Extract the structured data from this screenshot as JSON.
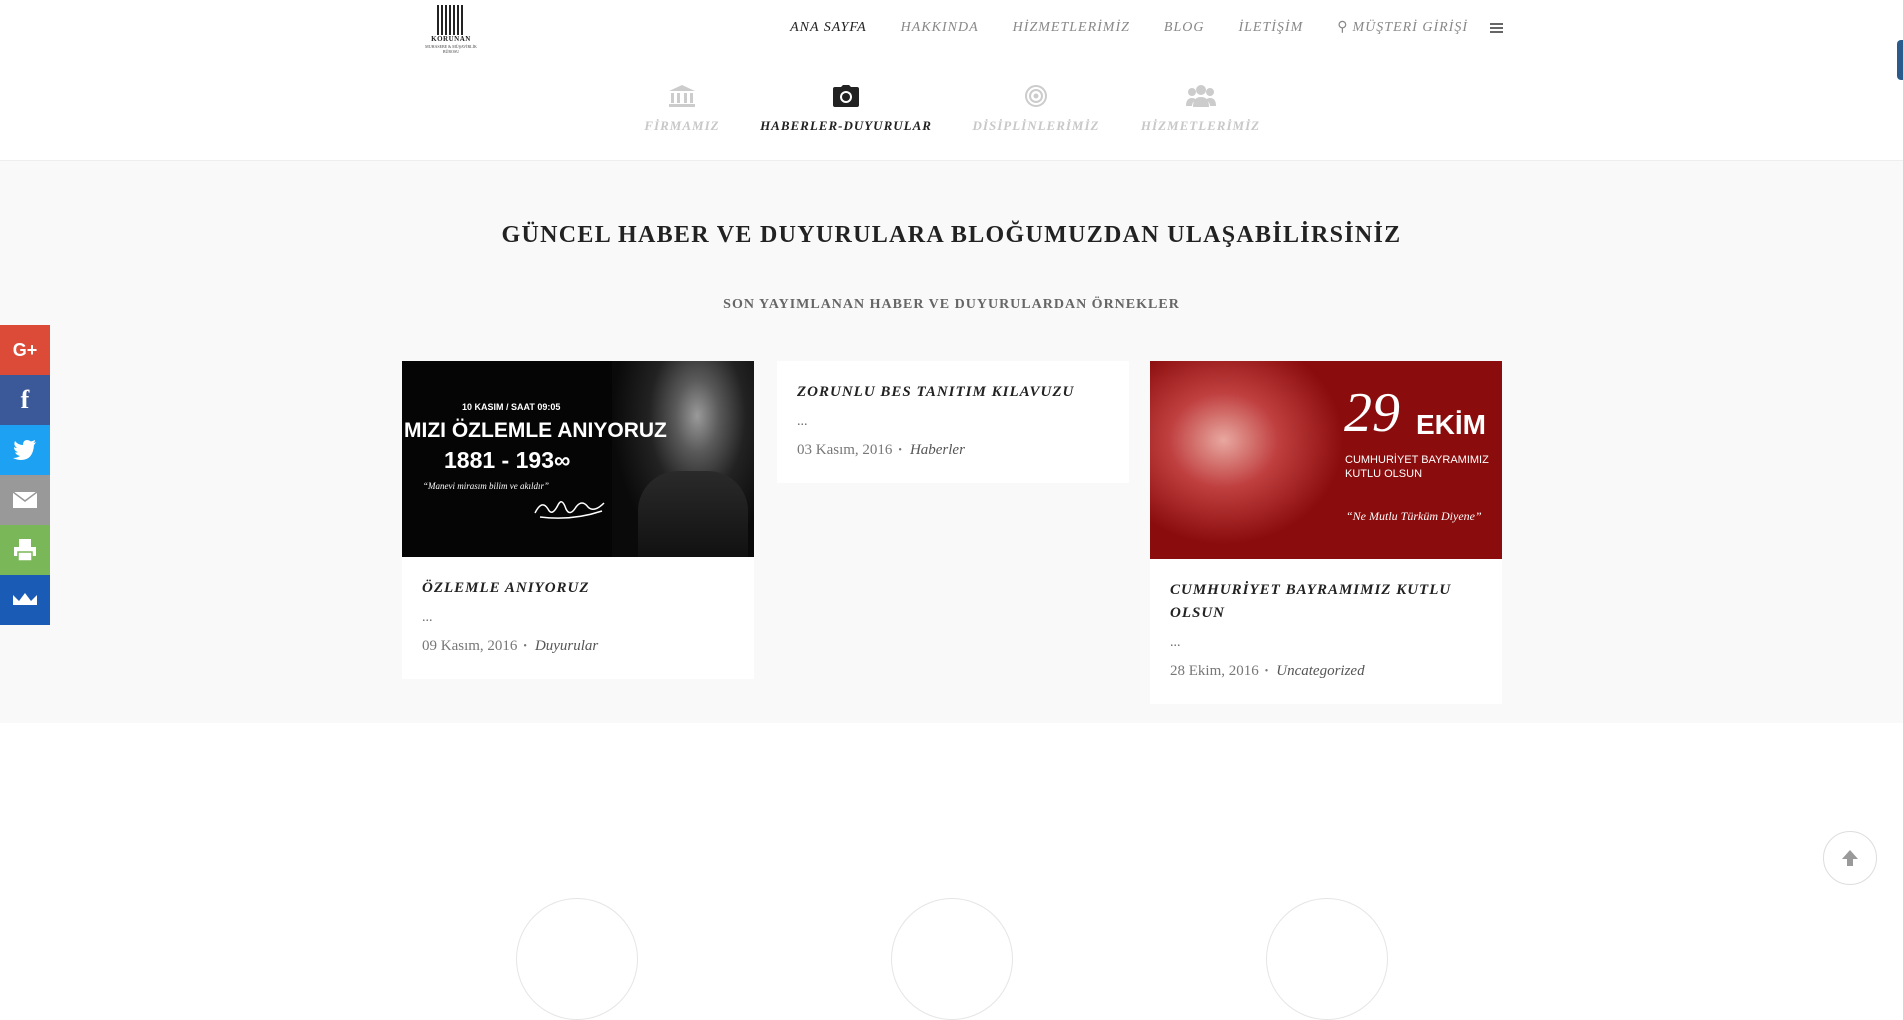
{
  "logo": {
    "name": "KORUNAN",
    "tagline": "MUHASEBE & MÜŞAVİRLİK BÜROSU"
  },
  "nav": {
    "items": [
      "ANA SAYFA",
      "HAKKINDA",
      "HİZMETLERİMİZ",
      "BLOG",
      "İLETİŞİM"
    ],
    "login": "MÜŞTERİ GİRİŞİ"
  },
  "subnav": {
    "items": [
      {
        "label": "FİRMAMIZ",
        "icon": "bank-icon"
      },
      {
        "label": "HABERLER-DUYURULAR",
        "icon": "camera-icon"
      },
      {
        "label": "DİSİPLİNLERİMİZ",
        "icon": "target-icon"
      },
      {
        "label": "HİZMETLERİMİZ",
        "icon": "users-icon"
      }
    ],
    "active": "HABERLER-DUYURULAR"
  },
  "section": {
    "title": "GÜNCEL HABER VE DUYURULARA BLOĞUMUZDAN ULAŞABİLİRSİNİZ",
    "subtitle": "SON YAYIMLANAN HABER VE DUYURULARDAN ÖRNEKLER"
  },
  "posts": [
    {
      "title": "ÖZLEMLE ANIYORUZ",
      "excerpt": "...",
      "date": "09 Kasım, 2016",
      "category": "Duyurular",
      "image": {
        "top_line": "10 KASIM / SAAT 09:05",
        "headline": "MIZI ÖZLEMLE ANIYORUZ",
        "years": "1881 - 193∞",
        "quote": "“Manevi mirasım bilim ve akıldır”"
      }
    },
    {
      "title": "ZORUNLU BES TANITIM KILAVUZU",
      "excerpt": "...",
      "date": "03 Kasım, 2016",
      "category": "Haberler"
    },
    {
      "title": "CUMHURİYET BAYRAMIMIZ KUTLU OLSUN",
      "excerpt": "...",
      "date": "28 Ekim, 2016",
      "category": "Uncategorized",
      "image": {
        "day": "29",
        "month": "EKİM",
        "line1": "CUMHURİYET BAYRAMIMIZ",
        "line2": "KUTLU OLSUN",
        "quote": "“Ne Mutlu Türküm Diyene”"
      }
    }
  ],
  "share": [
    {
      "label": "G+",
      "icon": "google-plus-icon",
      "color": "#dc4a38"
    },
    {
      "label": "f",
      "icon": "facebook-icon",
      "color": "#3b5998"
    },
    {
      "label": "",
      "icon": "twitter-icon",
      "color": "#1da1f2"
    },
    {
      "label": "",
      "icon": "mail-icon",
      "color": "#999999"
    },
    {
      "label": "",
      "icon": "print-icon",
      "color": "#7ab758"
    },
    {
      "label": "",
      "icon": "sumome-icon",
      "color": "#1a5bb5"
    }
  ]
}
